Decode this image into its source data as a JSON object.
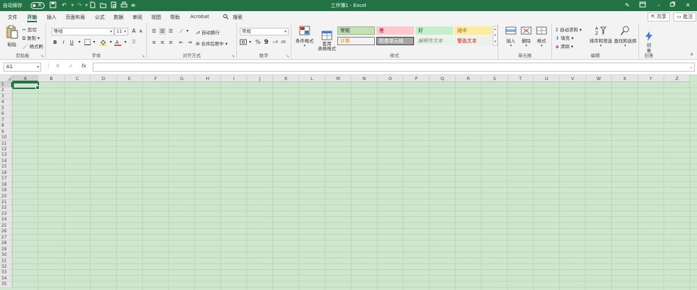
{
  "titlebar": {
    "autosave_label": "自动保存",
    "autosave_state": "关",
    "window_title": "工作簿1 - Excel",
    "qat_icons": [
      "save-icon",
      "undo-icon",
      "redo-icon",
      "new-file-icon",
      "open-file-icon",
      "print-preview-icon",
      "print-icon",
      "customize-qat-icon"
    ],
    "controls": [
      "pen-icon",
      "ribbon-display-icon",
      "minimize-icon",
      "restore-icon",
      "close-icon"
    ]
  },
  "tabs": {
    "items": [
      "文件",
      "开始",
      "插入",
      "页面布局",
      "公式",
      "数据",
      "审阅",
      "视图",
      "帮助",
      "Acrobat"
    ],
    "active": "开始",
    "search_label": "搜索",
    "share_label": "共享",
    "comment_label": "批注"
  },
  "ribbon": {
    "clipboard": {
      "paste": "粘贴",
      "cut": "剪切",
      "copy": "复制",
      "format_painter": "格式刷",
      "label": "剪贴板"
    },
    "font": {
      "font_name": "等线",
      "font_size": "11",
      "bold": "B",
      "italic": "I",
      "underline": "U",
      "label": "字体",
      "grow": "A",
      "shrink": "A",
      "accent_underline": "#e2231a",
      "accent_fill": "#ffe000"
    },
    "alignment": {
      "wrap_text": "自动换行",
      "merge_center": "合并后居中",
      "label": "对齐方式"
    },
    "number": {
      "format": "常规",
      "percent": "%",
      "comma": "9",
      "label": "数字"
    },
    "styles": {
      "conditional": "条件格式",
      "table_format": "套用\n表格格式",
      "cells": [
        {
          "name": "常规",
          "bg": "#c6e0b4",
          "fg": "#222222",
          "border": "#8fb98b"
        },
        {
          "name": "差",
          "bg": "#ffc7ce",
          "fg": "#9c0006",
          "border": "#ffc7ce"
        },
        {
          "name": "好",
          "bg": "#c6efce",
          "fg": "#006100",
          "border": "#c6efce"
        },
        {
          "name": "适中",
          "bg": "#ffeb9c",
          "fg": "#9c5700",
          "border": "#ffeb9c"
        },
        {
          "name": "计算",
          "bg": "#f2f2f2",
          "fg": "#fa7d00",
          "border": "#7f7f7f"
        },
        {
          "name": "检查单元格",
          "bg": "#a5a5a5",
          "fg": "#ffffff",
          "border": "#3f3f3f"
        },
        {
          "name": "解释性文本",
          "bg": "#e8f4ea",
          "fg": "#7f7f7f",
          "border": "#e8f4ea"
        },
        {
          "name": "警告文本",
          "bg": "#e8f4ea",
          "fg": "#ff0000",
          "border": "#e8f4ea"
        }
      ],
      "label": "样式"
    },
    "cells": {
      "insert": "插入",
      "delete": "删除",
      "format": "格式",
      "label": "单元格"
    },
    "editing": {
      "autosum": "自动求和",
      "fill": "填充",
      "clear": "清除",
      "sort_filter": "排序和筛选",
      "find_select": "查找和选择",
      "label": "编辑"
    },
    "creative": {
      "create": "创\n意",
      "label": "创意"
    }
  },
  "formula_bar": {
    "name_box": "A1",
    "cancel": "✕",
    "enter": "✓",
    "fx": "fx",
    "value": ""
  },
  "grid": {
    "columns": [
      "A",
      "B",
      "C",
      "D",
      "E",
      "F",
      "G",
      "H",
      "I",
      "J",
      "K",
      "L",
      "M",
      "N",
      "O",
      "P",
      "Q",
      "R",
      "S",
      "T",
      "U",
      "V",
      "W",
      "X",
      "Y",
      "Z"
    ],
    "rows": [
      "1",
      "2",
      "3",
      "4",
      "5",
      "6",
      "7",
      "8",
      "9",
      "10",
      "11",
      "12",
      "13",
      "14",
      "15",
      "16",
      "17",
      "18",
      "19",
      "20",
      "21",
      "22",
      "23",
      "24",
      "25",
      "26",
      "27",
      "28",
      "29",
      "30",
      "31",
      "32",
      "33",
      "34",
      "35"
    ],
    "active_cell": "A1",
    "cell_bg": "#cde8cf",
    "accent": "#217346"
  }
}
